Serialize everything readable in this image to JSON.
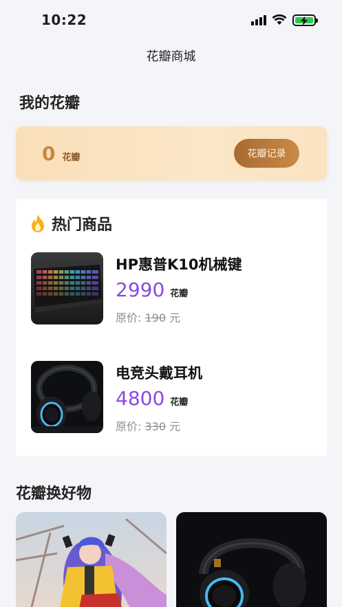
{
  "status": {
    "time": "10:22"
  },
  "nav": {
    "title": "花瓣商城"
  },
  "my_petals": {
    "title": "我的花瓣",
    "count": "0",
    "unit": "花瓣",
    "record_button": "花瓣记录"
  },
  "hot": {
    "title": "热门商品",
    "products": [
      {
        "name": "HP惠普K10机械键",
        "price": "2990",
        "unit": "花瓣",
        "orig_label": "原价:",
        "orig_price": "190",
        "currency": "元"
      },
      {
        "name": "电竞头戴耳机",
        "price": "4800",
        "unit": "花瓣",
        "orig_label": "原价:",
        "orig_price": "330",
        "currency": "元"
      }
    ]
  },
  "goods": {
    "title": "花瓣换好物"
  },
  "colors": {
    "price": "#8a49e0",
    "petal_count": "#c9873e",
    "button": "#b37a3c",
    "background": "#f4f5f8"
  },
  "icons": {
    "hot": "flame-icon",
    "signal": "cellular-signal-icon",
    "wifi": "wifi-icon",
    "battery": "battery-charging-icon"
  }
}
